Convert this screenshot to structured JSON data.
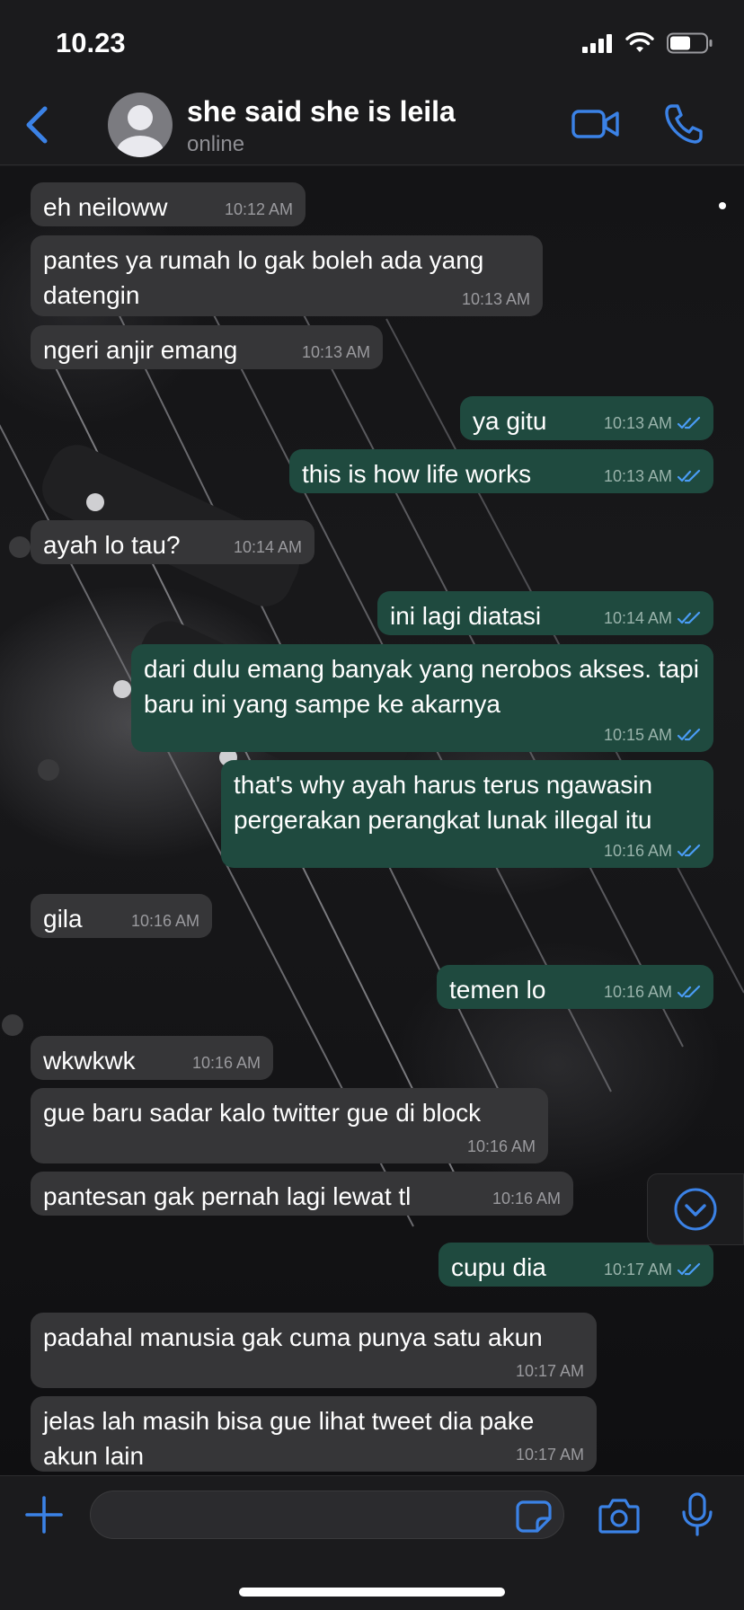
{
  "status_bar": {
    "time": "10.23"
  },
  "header": {
    "contact_name": "she said she is leila",
    "contact_status": "online"
  },
  "messages": [
    {
      "text": "eh neiloww",
      "time": "10:12 AM",
      "direction": "in"
    },
    {
      "text": "pantes ya rumah lo gak boleh ada yang datengin",
      "time": "10:13 AM",
      "direction": "in"
    },
    {
      "text": "ngeri anjir emang",
      "time": "10:13 AM",
      "direction": "in"
    },
    {
      "text": "ya gitu",
      "time": "10:13 AM",
      "direction": "out",
      "status": "read"
    },
    {
      "text": "this is how life works",
      "time": "10:13 AM",
      "direction": "out",
      "status": "read"
    },
    {
      "text": "ayah lo tau?",
      "time": "10:14 AM",
      "direction": "in"
    },
    {
      "text": "ini lagi diatasi",
      "time": "10:14 AM",
      "direction": "out",
      "status": "read"
    },
    {
      "text": "dari dulu emang banyak yang nerobos akses. tapi baru ini yang sampe ke akarnya",
      "time": "10:15 AM",
      "direction": "out",
      "status": "read"
    },
    {
      "text": "that's why ayah harus terus ngawasin pergerakan perangkat lunak illegal itu",
      "time": "10:16 AM",
      "direction": "out",
      "status": "read"
    },
    {
      "text": "gila",
      "time": "10:16 AM",
      "direction": "in"
    },
    {
      "text": "temen lo",
      "time": "10:16 AM",
      "direction": "out",
      "status": "read"
    },
    {
      "text": "wkwkwk",
      "time": "10:16 AM",
      "direction": "in"
    },
    {
      "text": "gue baru sadar kalo twitter gue di block",
      "time": "10:16 AM",
      "direction": "in"
    },
    {
      "text": "pantesan gak pernah lagi lewat tl",
      "time": "10:16 AM",
      "direction": "in"
    },
    {
      "text": "cupu dia",
      "time": "10:17 AM",
      "direction": "out",
      "status": "read"
    },
    {
      "text": "padahal manusia gak cuma punya satu akun",
      "time": "10:17 AM",
      "direction": "in"
    },
    {
      "text": "jelas lah masih bisa gue lihat tweet dia pake akun lain",
      "time": "10:17 AM",
      "direction": "in"
    }
  ],
  "input_bar": {
    "placeholder": ""
  },
  "colors": {
    "accent": "#3b82e6",
    "incoming_bubble": "#363638",
    "outgoing_bubble": "#1f4a3f",
    "background": "#1b1b1d"
  },
  "icons": [
    "back-chevron-icon",
    "video-call-icon",
    "phone-icon",
    "plus-icon",
    "sticker-icon",
    "camera-icon",
    "microphone-icon",
    "chevron-down-icon",
    "double-check-icon"
  ]
}
